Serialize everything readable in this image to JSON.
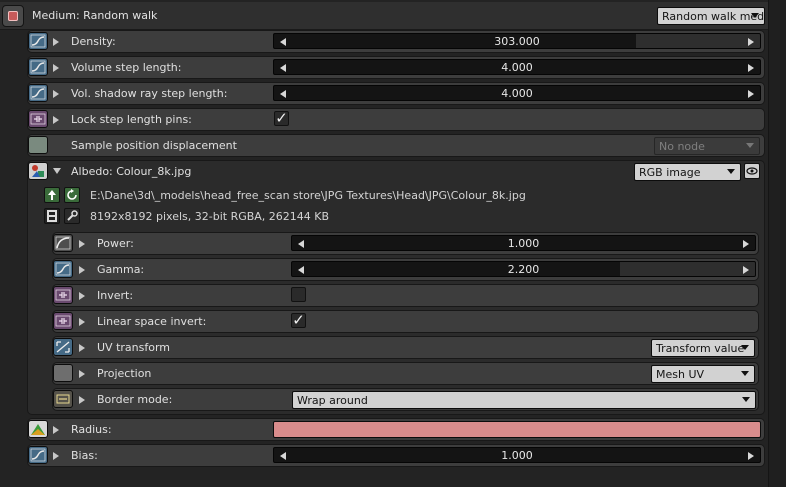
{
  "medium": {
    "title": "Medium: Random walk",
    "type_select": "Random walk medium"
  },
  "params": [
    {
      "label": "Density:",
      "value": "303.000",
      "icon": "curve-icon"
    },
    {
      "label": "Volume step length:",
      "value": "4.000",
      "icon": "curve-icon"
    },
    {
      "label": "Vol. shadow ray step length:",
      "value": "4.000",
      "icon": "curve-icon"
    },
    {
      "label": "Lock step length pins:",
      "checked": "✓",
      "icon": "toggle-icon"
    },
    {
      "label": "Sample position displacement",
      "node": "No node"
    }
  ],
  "albedo": {
    "label": "Albedo: Colour_8k.jpg",
    "type_select": "RGB image",
    "path": "E:\\Dane\\3d\\_models\\head_free_scan store\\JPG Textures\\Head\\JPG\\Colour_8k.jpg",
    "info": "8192x8192 pixels, 32-bit RGBA, 262144 KB",
    "power": {
      "label": "Power:",
      "value": "1.000"
    },
    "gamma": {
      "label": "Gamma:",
      "value": "2.200"
    },
    "invert": {
      "label": "Invert:"
    },
    "linear_invert": {
      "label": "Linear space invert:",
      "checked": "✓"
    },
    "uv_transform": {
      "label": "UV transform",
      "select": "Transform value"
    },
    "projection": {
      "label": "Projection",
      "select": "Mesh UV"
    },
    "border_mode": {
      "label": "Border mode:",
      "select": "Wrap around"
    }
  },
  "radius": {
    "label": "Radius:",
    "color": "#d98c8c"
  },
  "bias": {
    "label": "Bias:",
    "value": "1.000"
  }
}
